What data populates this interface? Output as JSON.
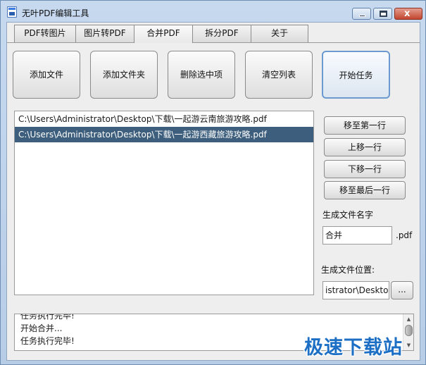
{
  "window": {
    "title": "无叶PDF编辑工具",
    "controls": {
      "minimize": "minimize",
      "maximize": "maximize",
      "close": "x"
    }
  },
  "tabs": [
    {
      "label": "PDF转图片",
      "active": false
    },
    {
      "label": "图片转PDF",
      "active": false
    },
    {
      "label": "合并PDF",
      "active": true
    },
    {
      "label": "拆分PDF",
      "active": false
    },
    {
      "label": "关于",
      "active": false
    }
  ],
  "toolbar": {
    "add_file": "添加文件",
    "add_folder": "添加文件夹",
    "delete_selected": "删除选中项",
    "clear_list": "清空列表",
    "start_task": "开始任务"
  },
  "files": [
    {
      "path": "C:\\Users\\Administrator\\Desktop\\下载\\一起游云南旅游攻略.pdf",
      "selected": false
    },
    {
      "path": "C:\\Users\\Administrator\\Desktop\\下载\\一起游西藏旅游攻略.pdf",
      "selected": true
    }
  ],
  "side": {
    "move_top": "移至第一行",
    "move_up": "上移一行",
    "move_down": "下移一行",
    "move_bottom": "移至最后一行",
    "output_name_label": "生成文件名字",
    "output_name_value": "合并",
    "ext_label": ".pdf",
    "output_dir_label": "生成文件位置:",
    "output_dir_value": "istrator\\Desktop",
    "browse_label": "..."
  },
  "log": [
    "任务执行完毕!",
    "开始合并...",
    "任务执行完毕!"
  ],
  "watermark": "极速下载站",
  "colors": {
    "selected_row": "#3d5f7d",
    "watermark": "#1c6fc4"
  }
}
